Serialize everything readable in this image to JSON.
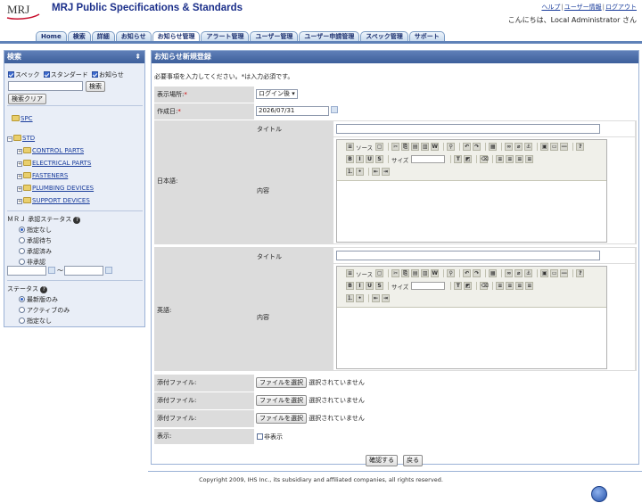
{
  "header": {
    "logo_text": "MRJ",
    "title": "MRJ Public Specifications & Standards",
    "links": [
      "ヘルプ",
      "ユーザー情報",
      "ログアウト"
    ],
    "greeting": "こんにちは、Local Administrator さん"
  },
  "tabs": [
    "Home",
    "検索",
    "詳細",
    "お知らせ",
    "お知らせ管理",
    "アラート管理",
    "ユーザー管理",
    "ユーザー申請管理",
    "スペック管理",
    "サポート"
  ],
  "sidebar": {
    "title": "検索",
    "filters": [
      {
        "label": "スペック",
        "checked": true
      },
      {
        "label": "スタンダード",
        "checked": true
      },
      {
        "label": "お知らせ",
        "checked": true
      }
    ],
    "search_button": "検索",
    "clear_button": "検索クリア",
    "tree": {
      "spc": "SPC",
      "std": "STD",
      "children": [
        "CONTROL PARTS",
        "ELECTRICAL PARTS",
        "FASTENERS",
        "PLUMBING DEVICES",
        "SUPPORT DEVICES"
      ]
    },
    "approval_title": "ＭＲＪ 承認ステータス",
    "approval_options": [
      "指定なし",
      "承認待ち",
      "承認済み",
      "非承認"
    ],
    "date_sep": "～",
    "status_title": "ステータス",
    "status_options": [
      "最新版のみ",
      "アクティブのみ",
      "指定なし"
    ]
  },
  "main": {
    "title": "お知らせ新規登録",
    "required_note": "必要事項を入力してください。*は入力必須です。",
    "display_location": {
      "label": "表示場所:",
      "value": "ログイン後"
    },
    "created_date": {
      "label": "作成日:",
      "value": "2026/07/31"
    },
    "japanese": {
      "label": "日本語:",
      "title_label": "タイトル",
      "content_label": "内容"
    },
    "english": {
      "label": "英語:",
      "title_label": "タイトル",
      "content_label": "内容"
    },
    "editor": {
      "source": "ソース",
      "size": "サイズ"
    },
    "attachments": [
      {
        "label": "添付ファイル:",
        "button": "ファイルを選択",
        "status": "選択されていません"
      },
      {
        "label": "添付ファイル:",
        "button": "ファイルを選択",
        "status": "選択されていません"
      },
      {
        "label": "添付ファイル:",
        "button": "ファイルを選択",
        "status": "選択されていません"
      }
    ],
    "display": {
      "label": "表示:",
      "checkbox": "非表示"
    },
    "confirm_button": "確認する",
    "back_button": "戻る"
  },
  "footer": {
    "copyright": "Copyright 2009, IHS Inc., its subsidiary and affiliated companies, all rights reserved."
  },
  "colors": {
    "brand": "#1b2f8a",
    "panel_header": "#4a6aa5",
    "tab_border": "#7d9dc5"
  }
}
